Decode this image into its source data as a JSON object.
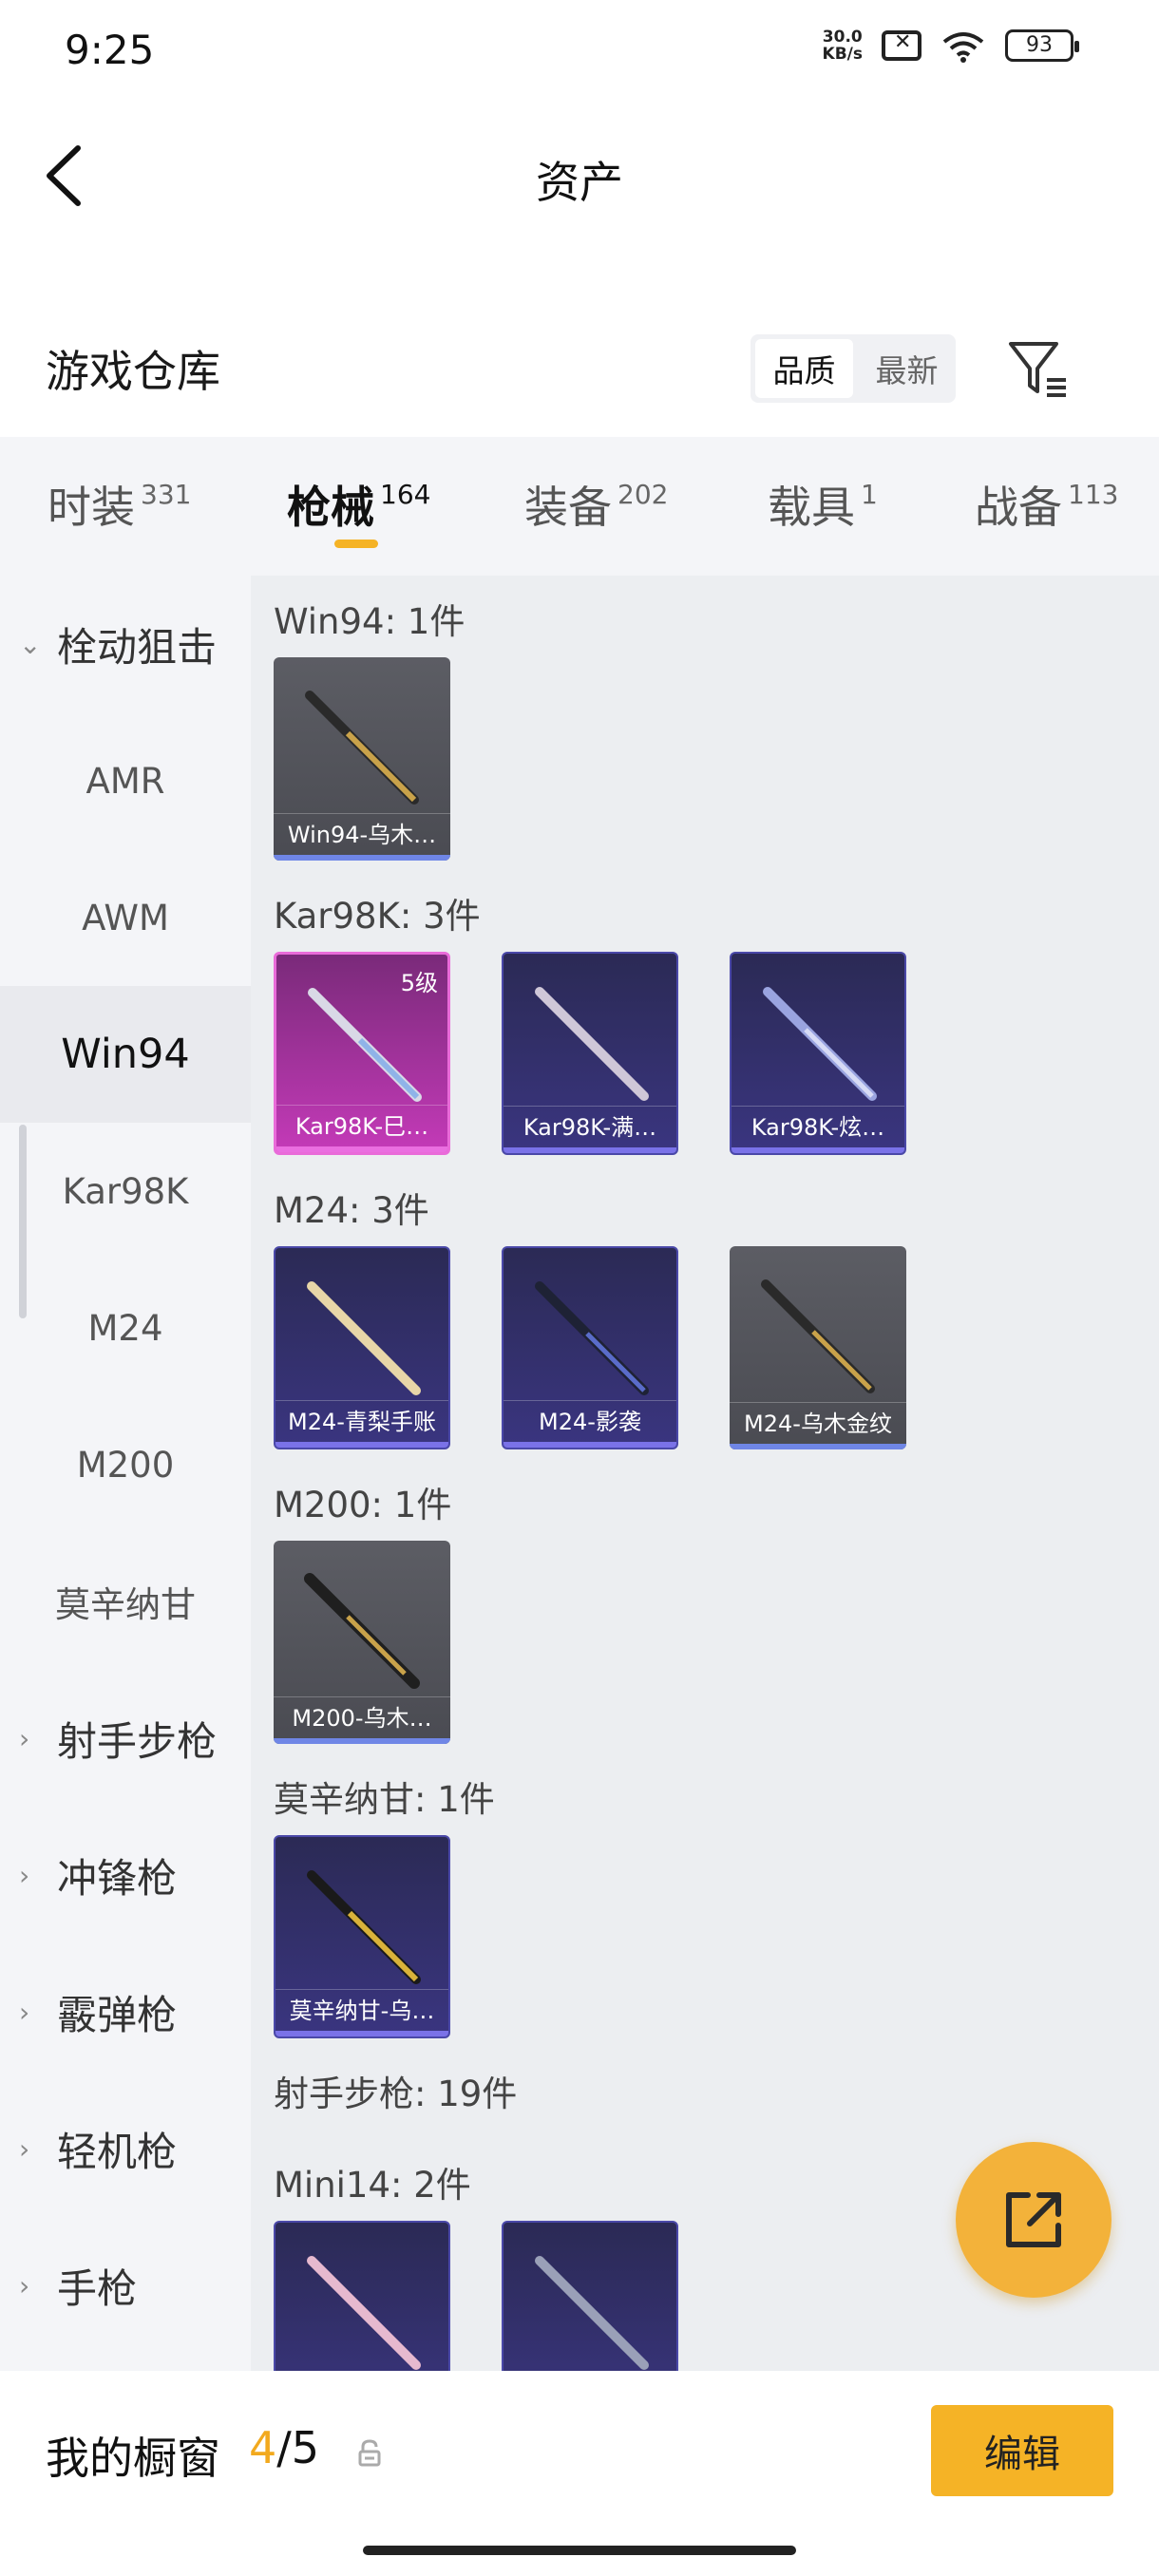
{
  "status_bar": {
    "time": "9:25",
    "speed_value": "30.0",
    "speed_unit": "KB/s",
    "battery": "93"
  },
  "header": {
    "title": "资产"
  },
  "warehouse": {
    "title": "游戏仓库",
    "sort_options": [
      "品质",
      "最新"
    ],
    "active_sort": "品质"
  },
  "tabs": [
    {
      "label": "时装",
      "count": "331"
    },
    {
      "label": "枪械",
      "count": "164",
      "active": true
    },
    {
      "label": "装备",
      "count": "202"
    },
    {
      "label": "载具",
      "count": "1"
    },
    {
      "label": "战备",
      "count": "113"
    }
  ],
  "categories": [
    {
      "label": "栓动狙击",
      "type": "group",
      "expanded": true
    },
    {
      "label": "AMR",
      "type": "sub"
    },
    {
      "label": "AWM",
      "type": "sub"
    },
    {
      "label": "Win94",
      "type": "sub",
      "selected": true
    },
    {
      "label": "Kar98K",
      "type": "sub"
    },
    {
      "label": "M24",
      "type": "sub"
    },
    {
      "label": "M200",
      "type": "sub"
    },
    {
      "label": "莫辛纳甘",
      "type": "sub"
    },
    {
      "label": "射手步枪",
      "type": "group"
    },
    {
      "label": "冲锋枪",
      "type": "group"
    },
    {
      "label": "霰弹枪",
      "type": "group"
    },
    {
      "label": "轻机枪",
      "type": "group"
    },
    {
      "label": "手枪",
      "type": "group"
    }
  ],
  "sections": [
    {
      "title": "Win94: 1件",
      "items": [
        {
          "name": "Win94-乌木…",
          "rarity": "grey"
        }
      ]
    },
    {
      "title": "Kar98K: 3件",
      "items": [
        {
          "name": "Kar98K-巳…",
          "rarity": "pink",
          "level": "5级"
        },
        {
          "name": "Kar98K-满…",
          "rarity": "purple"
        },
        {
          "name": "Kar98K-炫…",
          "rarity": "purple"
        }
      ]
    },
    {
      "title": "M24: 3件",
      "items": [
        {
          "name": "M24-青梨手账",
          "rarity": "purple"
        },
        {
          "name": "M24-影袭",
          "rarity": "purple"
        },
        {
          "name": "M24-乌木金纹",
          "rarity": "grey"
        }
      ]
    },
    {
      "title": "M200: 1件",
      "items": [
        {
          "name": "M200-乌木…",
          "rarity": "grey"
        }
      ]
    },
    {
      "title": "莫辛纳甘: 1件",
      "items": [
        {
          "name": "莫辛纳甘-乌…",
          "rarity": "purple"
        }
      ]
    },
    {
      "title": "射手步枪: 19件"
    },
    {
      "title": "Mini14: 2件",
      "items": [
        {
          "name": "",
          "rarity": "purple"
        },
        {
          "name": "",
          "rarity": "purple"
        }
      ]
    }
  ],
  "bottom": {
    "label": "我的橱窗",
    "count_current": "4",
    "count_sep": "/",
    "count_total": "5",
    "edit_label": "编辑"
  },
  "colors": {
    "accent": "#f5b326",
    "pink": "#e96bd9",
    "purple": "#4a48a8",
    "grey": "#4a4b52"
  }
}
